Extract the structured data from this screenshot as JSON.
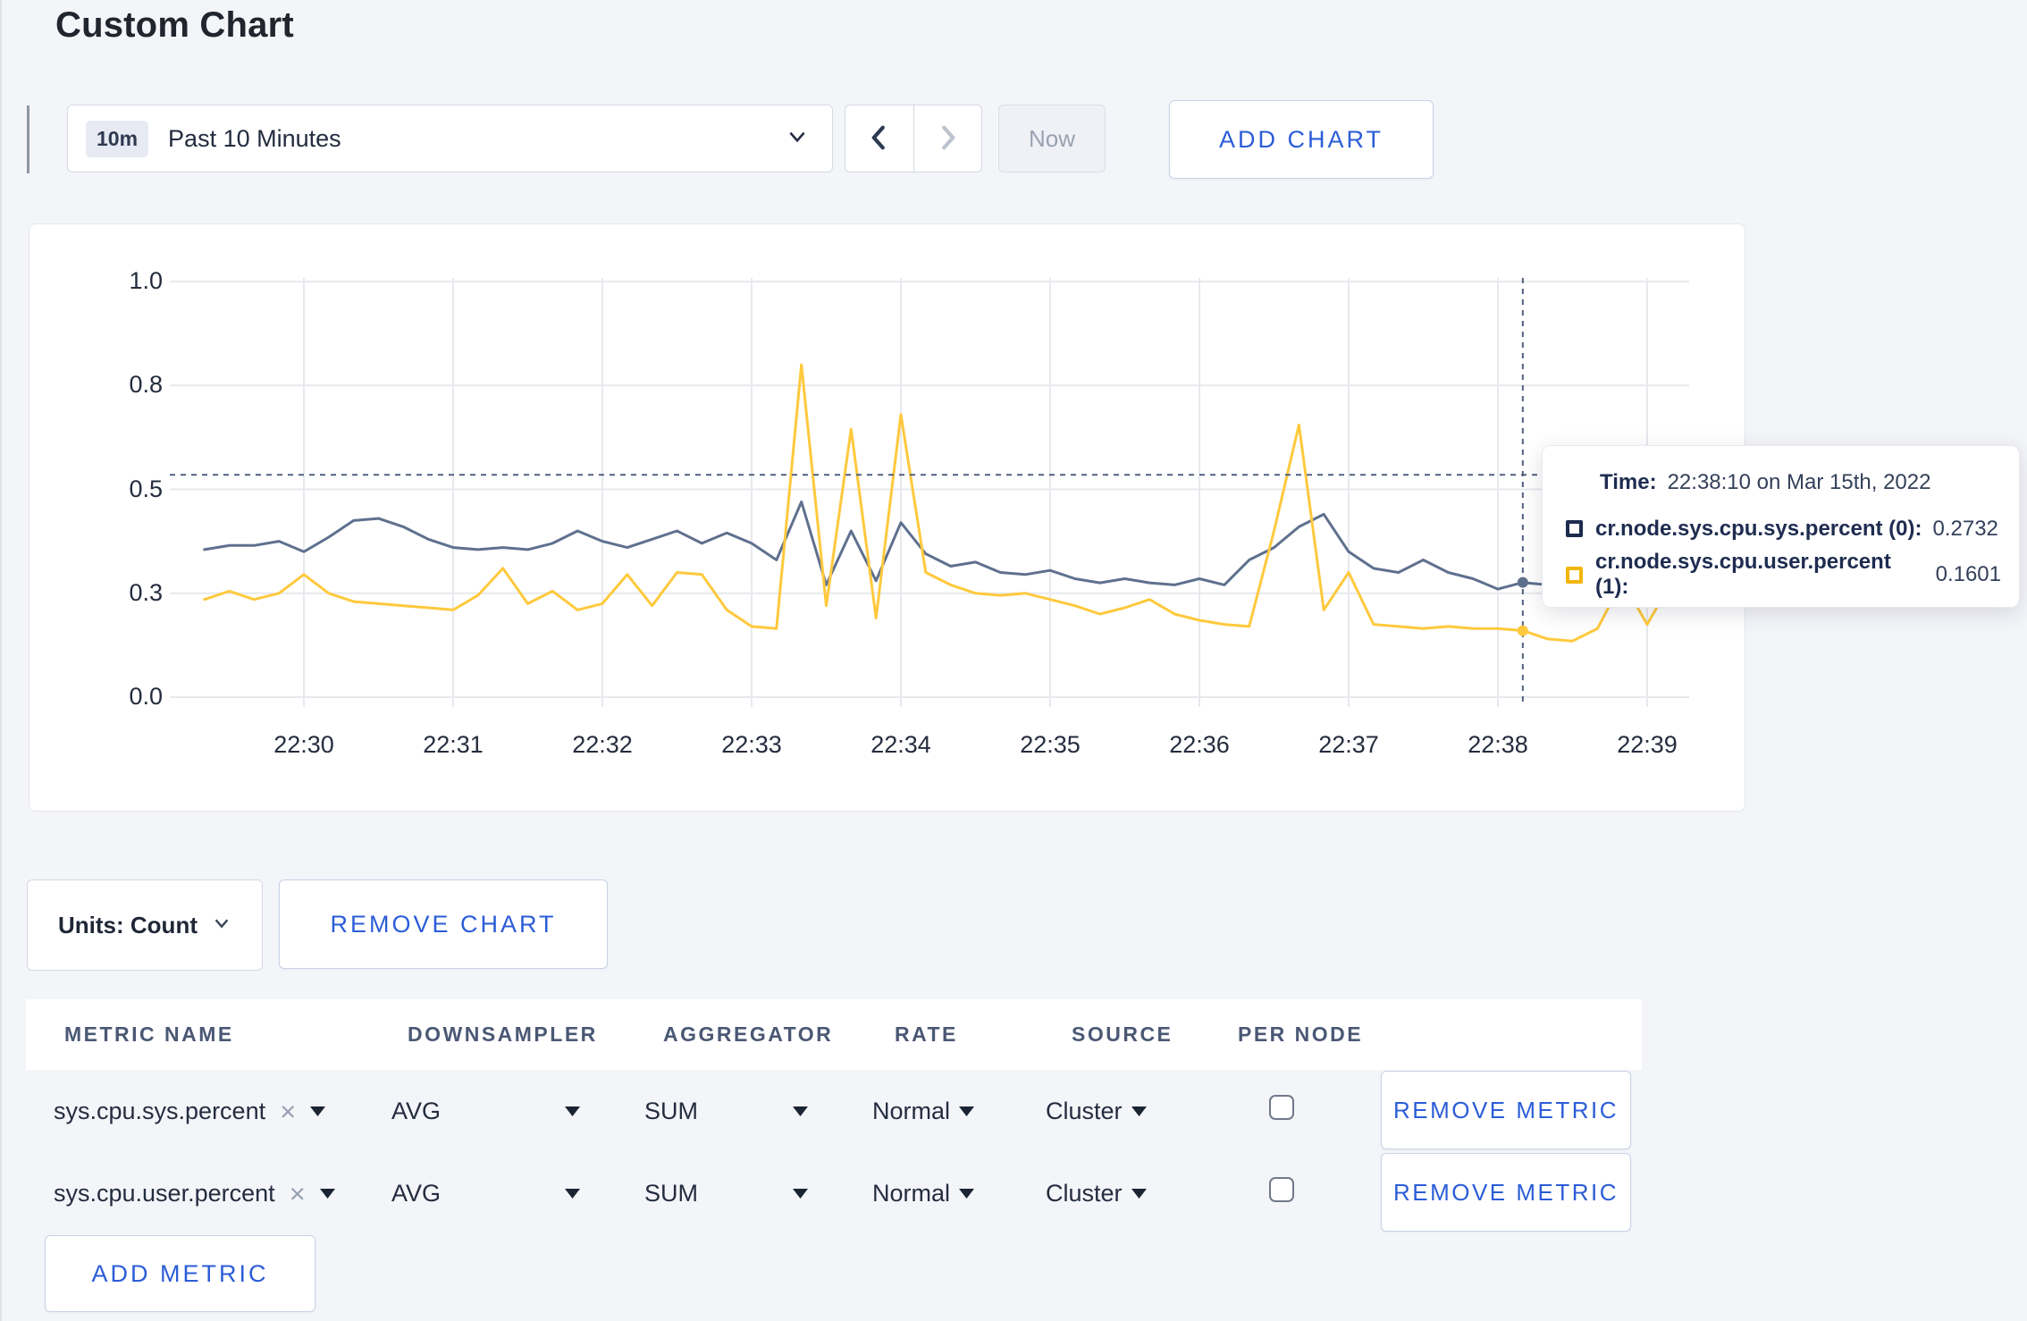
{
  "header": {
    "title": "Custom Chart"
  },
  "toolbar": {
    "time_range": {
      "badge": "10m",
      "label": "Past 10 Minutes"
    },
    "now_label": "Now",
    "add_chart_label": "ADD CHART"
  },
  "icons": {
    "clear_x": "×"
  },
  "colors": {
    "accent_blue": "#2b5dd7",
    "series_sys": "#5f708e",
    "series_user": "#ffc93d",
    "crosshair": "#51617e",
    "grid": "#e7e9ee"
  },
  "chart": {
    "tooltip": {
      "time_label": "Time:",
      "time_value": "22:38:10 on Mar 15th, 2022",
      "series": [
        {
          "name": "cr.node.sys.cpu.sys.percent (0):",
          "value": "0.2732",
          "color": "#1c2b4d"
        },
        {
          "name": "cr.node.sys.cpu.user.percent (1):",
          "value": "0.1601",
          "color": "#f2b60b"
        }
      ]
    }
  },
  "chart_data": {
    "type": "line",
    "title": "",
    "xlabel": "",
    "ylabel": "",
    "ylim": [
      0,
      1
    ],
    "grid": true,
    "legend_position": "tooltip",
    "y_ticks": [
      {
        "label": "1.0",
        "value": 1.0
      },
      {
        "label": "0.8",
        "value": 0.75
      },
      {
        "label": "0.5",
        "value": 0.5
      },
      {
        "label": "0.3",
        "value": 0.25
      },
      {
        "label": "0.0",
        "value": 0.0
      }
    ],
    "x_ticks": [
      "22:30",
      "22:31",
      "22:32",
      "22:33",
      "22:34",
      "22:35",
      "22:36",
      "22:37",
      "22:38",
      "22:39"
    ],
    "x_start_minutes": -0.6667,
    "x_step_minutes": 0.16667,
    "series": [
      {
        "name": "cr.node.sys.cpu.sys.percent",
        "color": "#5f708e",
        "values": [
          0.355,
          0.365,
          0.365,
          0.375,
          0.35,
          0.385,
          0.425,
          0.43,
          0.41,
          0.38,
          0.36,
          0.355,
          0.36,
          0.355,
          0.37,
          0.4,
          0.375,
          0.36,
          0.38,
          0.4,
          0.37,
          0.395,
          0.37,
          0.33,
          0.47,
          0.27,
          0.4,
          0.28,
          0.42,
          0.345,
          0.315,
          0.325,
          0.3,
          0.295,
          0.305,
          0.285,
          0.275,
          0.285,
          0.275,
          0.27,
          0.285,
          0.27,
          0.33,
          0.36,
          0.41,
          0.44,
          0.35,
          0.31,
          0.3,
          0.33,
          0.3,
          0.285,
          0.26,
          0.276,
          0.27,
          0.28,
          0.29,
          0.3,
          0.295,
          0.31
        ]
      },
      {
        "name": "cr.node.sys.cpu.user.percent",
        "color": "#ffc93d",
        "values": [
          0.235,
          0.255,
          0.235,
          0.25,
          0.295,
          0.25,
          0.23,
          0.225,
          0.22,
          0.215,
          0.21,
          0.245,
          0.31,
          0.225,
          0.255,
          0.21,
          0.225,
          0.295,
          0.22,
          0.3,
          0.295,
          0.21,
          0.17,
          0.165,
          0.8,
          0.22,
          0.645,
          0.19,
          0.68,
          0.3,
          0.27,
          0.25,
          0.245,
          0.25,
          0.235,
          0.22,
          0.2,
          0.215,
          0.235,
          0.2,
          0.185,
          0.175,
          0.17,
          0.4,
          0.655,
          0.21,
          0.3,
          0.175,
          0.17,
          0.165,
          0.17,
          0.165,
          0.165,
          0.16,
          0.14,
          0.135,
          0.165,
          0.28,
          0.175,
          0.28
        ]
      }
    ],
    "crosshair": {
      "time": "22:38:10",
      "x_minutes": 8.1667,
      "y_value": 0.535,
      "point_values": [
        0.276,
        0.16
      ],
      "color": "#51617e"
    }
  },
  "actions": {
    "units_label": "Units: Count",
    "remove_chart_label": "REMOVE CHART",
    "remove_metric_label": "REMOVE METRIC",
    "add_metric_label": "ADD METRIC"
  },
  "metrics": {
    "columns": [
      "METRIC NAME",
      "DOWNSAMPLER",
      "AGGREGATOR",
      "RATE",
      "SOURCE",
      "PER NODE"
    ],
    "rows": [
      {
        "name": "sys.cpu.sys.percent",
        "downsampler": "AVG",
        "aggregator": "SUM",
        "rate": "Normal",
        "source": "Cluster",
        "per_node": false
      },
      {
        "name": "sys.cpu.user.percent",
        "downsampler": "AVG",
        "aggregator": "SUM",
        "rate": "Normal",
        "source": "Cluster",
        "per_node": false
      }
    ]
  }
}
